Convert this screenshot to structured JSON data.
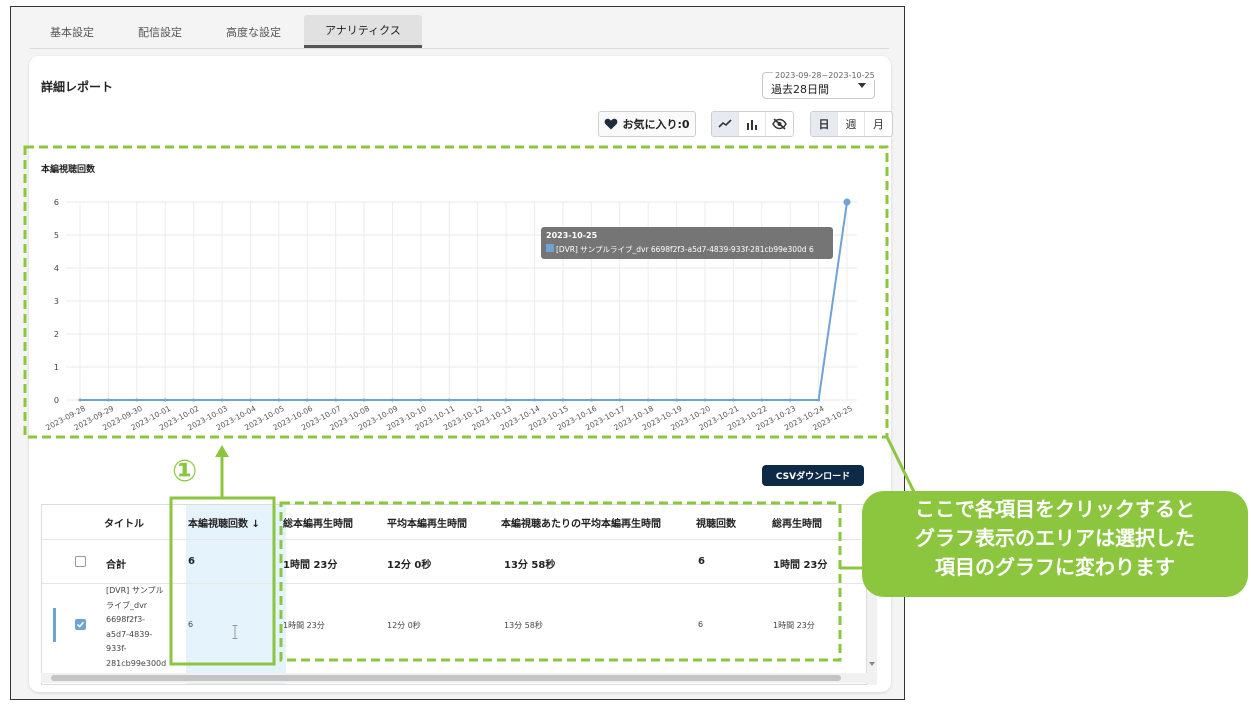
{
  "tabs": [
    {
      "label": "基本設定"
    },
    {
      "label": "配信設定"
    },
    {
      "label": "高度な設定"
    },
    {
      "label": "アナリティクス"
    }
  ],
  "report": {
    "title": "詳細レポート",
    "date_range": "2023-09-28~2023-10-25",
    "period": "過去28日間",
    "favorite_label": "お気に入り:0",
    "granularity": [
      "日",
      "週",
      "月"
    ],
    "selected_granularity": "日",
    "chart_heading": "本編視聴回数",
    "csv_label": "CSVダウンロード"
  },
  "chart_data": {
    "type": "line",
    "x": [
      "2023-09-28",
      "2023-09-29",
      "2023-09-30",
      "2023-10-01",
      "2023-10-02",
      "2023-10-03",
      "2023-10-04",
      "2023-10-05",
      "2023-10-06",
      "2023-10-07",
      "2023-10-08",
      "2023-10-09",
      "2023-10-10",
      "2023-10-11",
      "2023-10-12",
      "2023-10-13",
      "2023-10-14",
      "2023-10-15",
      "2023-10-16",
      "2023-10-17",
      "2023-10-18",
      "2023-10-19",
      "2023-10-20",
      "2023-10-21",
      "2023-10-22",
      "2023-10-23",
      "2023-10-24",
      "2023-10-25"
    ],
    "series": [
      {
        "name": "[DVR] サンプルライブ_dvr 6698f2f3-a5d7-4839-933f-281cb99e300d",
        "values": [
          0,
          0,
          0,
          0,
          0,
          0,
          0,
          0,
          0,
          0,
          0,
          0,
          0,
          0,
          0,
          0,
          0,
          0,
          0,
          0,
          0,
          0,
          0,
          0,
          0,
          0,
          0,
          6
        ],
        "color": "#6fa3d4"
      }
    ],
    "yticks": [
      0,
      1,
      2,
      3,
      4,
      5,
      6
    ],
    "ylim": [
      0,
      6
    ],
    "grid": true,
    "tooltip": {
      "date": "2023-10-25",
      "label": "[DVR] サンプルライブ_dvr 6698f2f3-a5d7-4839-933f-281cb99e300d",
      "value": "6"
    }
  },
  "table": {
    "headers": [
      "タイトル",
      "本編視聴回数 ↓",
      "総本編再生時間",
      "平均本編再生時間",
      "本編視聴あたりの平均本編再生時間",
      "視聴回数",
      "総再生時間"
    ],
    "total": {
      "label": "合計",
      "views": "6",
      "total_time": "1時間 23分",
      "avg_time": "12分 0秒",
      "avg_per_view": "13分 58秒",
      "plays": "6",
      "play_time": "1時間 23分"
    },
    "row": {
      "title_lines": [
        "[DVR] サンプル",
        "ライブ_dvr",
        "6698f2f3-",
        "a5d7-4839-",
        "933f-",
        "281cb99e300d"
      ],
      "views": "6",
      "total_time": "1時間 23分",
      "avg_time": "12分 0秒",
      "avg_per_view": "13分 58秒",
      "plays": "6",
      "play_time": "1時間 23分"
    }
  },
  "annotation": {
    "marker": "①",
    "callout_lines": [
      "ここで各項目をクリックすると",
      "グラフ表示のエリアは選択した",
      "項目のグラフに変わります"
    ],
    "accent": "#8cc63f"
  }
}
